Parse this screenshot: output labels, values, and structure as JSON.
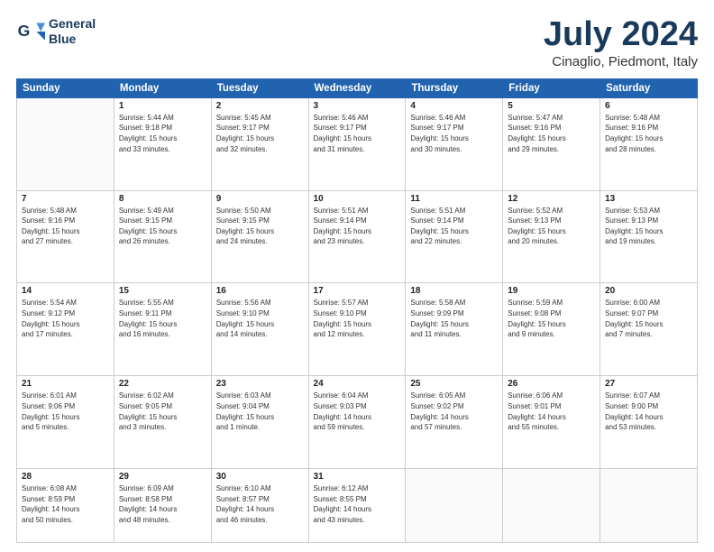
{
  "header": {
    "logo_line1": "General",
    "logo_line2": "Blue",
    "month": "July 2024",
    "location": "Cinaglio, Piedmont, Italy"
  },
  "days_of_week": [
    "Sunday",
    "Monday",
    "Tuesday",
    "Wednesday",
    "Thursday",
    "Friday",
    "Saturday"
  ],
  "weeks": [
    [
      {
        "num": "",
        "info": ""
      },
      {
        "num": "1",
        "info": "Sunrise: 5:44 AM\nSunset: 9:18 PM\nDaylight: 15 hours\nand 33 minutes."
      },
      {
        "num": "2",
        "info": "Sunrise: 5:45 AM\nSunset: 9:17 PM\nDaylight: 15 hours\nand 32 minutes."
      },
      {
        "num": "3",
        "info": "Sunrise: 5:46 AM\nSunset: 9:17 PM\nDaylight: 15 hours\nand 31 minutes."
      },
      {
        "num": "4",
        "info": "Sunrise: 5:46 AM\nSunset: 9:17 PM\nDaylight: 15 hours\nand 30 minutes."
      },
      {
        "num": "5",
        "info": "Sunrise: 5:47 AM\nSunset: 9:16 PM\nDaylight: 15 hours\nand 29 minutes."
      },
      {
        "num": "6",
        "info": "Sunrise: 5:48 AM\nSunset: 9:16 PM\nDaylight: 15 hours\nand 28 minutes."
      }
    ],
    [
      {
        "num": "7",
        "info": "Sunrise: 5:48 AM\nSunset: 9:16 PM\nDaylight: 15 hours\nand 27 minutes."
      },
      {
        "num": "8",
        "info": "Sunrise: 5:49 AM\nSunset: 9:15 PM\nDaylight: 15 hours\nand 26 minutes."
      },
      {
        "num": "9",
        "info": "Sunrise: 5:50 AM\nSunset: 9:15 PM\nDaylight: 15 hours\nand 24 minutes."
      },
      {
        "num": "10",
        "info": "Sunrise: 5:51 AM\nSunset: 9:14 PM\nDaylight: 15 hours\nand 23 minutes."
      },
      {
        "num": "11",
        "info": "Sunrise: 5:51 AM\nSunset: 9:14 PM\nDaylight: 15 hours\nand 22 minutes."
      },
      {
        "num": "12",
        "info": "Sunrise: 5:52 AM\nSunset: 9:13 PM\nDaylight: 15 hours\nand 20 minutes."
      },
      {
        "num": "13",
        "info": "Sunrise: 5:53 AM\nSunset: 9:13 PM\nDaylight: 15 hours\nand 19 minutes."
      }
    ],
    [
      {
        "num": "14",
        "info": "Sunrise: 5:54 AM\nSunset: 9:12 PM\nDaylight: 15 hours\nand 17 minutes."
      },
      {
        "num": "15",
        "info": "Sunrise: 5:55 AM\nSunset: 9:11 PM\nDaylight: 15 hours\nand 16 minutes."
      },
      {
        "num": "16",
        "info": "Sunrise: 5:56 AM\nSunset: 9:10 PM\nDaylight: 15 hours\nand 14 minutes."
      },
      {
        "num": "17",
        "info": "Sunrise: 5:57 AM\nSunset: 9:10 PM\nDaylight: 15 hours\nand 12 minutes."
      },
      {
        "num": "18",
        "info": "Sunrise: 5:58 AM\nSunset: 9:09 PM\nDaylight: 15 hours\nand 11 minutes."
      },
      {
        "num": "19",
        "info": "Sunrise: 5:59 AM\nSunset: 9:08 PM\nDaylight: 15 hours\nand 9 minutes."
      },
      {
        "num": "20",
        "info": "Sunrise: 6:00 AM\nSunset: 9:07 PM\nDaylight: 15 hours\nand 7 minutes."
      }
    ],
    [
      {
        "num": "21",
        "info": "Sunrise: 6:01 AM\nSunset: 9:06 PM\nDaylight: 15 hours\nand 5 minutes."
      },
      {
        "num": "22",
        "info": "Sunrise: 6:02 AM\nSunset: 9:05 PM\nDaylight: 15 hours\nand 3 minutes."
      },
      {
        "num": "23",
        "info": "Sunrise: 6:03 AM\nSunset: 9:04 PM\nDaylight: 15 hours\nand 1 minute."
      },
      {
        "num": "24",
        "info": "Sunrise: 6:04 AM\nSunset: 9:03 PM\nDaylight: 14 hours\nand 59 minutes."
      },
      {
        "num": "25",
        "info": "Sunrise: 6:05 AM\nSunset: 9:02 PM\nDaylight: 14 hours\nand 57 minutes."
      },
      {
        "num": "26",
        "info": "Sunrise: 6:06 AM\nSunset: 9:01 PM\nDaylight: 14 hours\nand 55 minutes."
      },
      {
        "num": "27",
        "info": "Sunrise: 6:07 AM\nSunset: 9:00 PM\nDaylight: 14 hours\nand 53 minutes."
      }
    ],
    [
      {
        "num": "28",
        "info": "Sunrise: 6:08 AM\nSunset: 8:59 PM\nDaylight: 14 hours\nand 50 minutes."
      },
      {
        "num": "29",
        "info": "Sunrise: 6:09 AM\nSunset: 8:58 PM\nDaylight: 14 hours\nand 48 minutes."
      },
      {
        "num": "30",
        "info": "Sunrise: 6:10 AM\nSunset: 8:57 PM\nDaylight: 14 hours\nand 46 minutes."
      },
      {
        "num": "31",
        "info": "Sunrise: 6:12 AM\nSunset: 8:55 PM\nDaylight: 14 hours\nand 43 minutes."
      },
      {
        "num": "",
        "info": ""
      },
      {
        "num": "",
        "info": ""
      },
      {
        "num": "",
        "info": ""
      }
    ]
  ]
}
